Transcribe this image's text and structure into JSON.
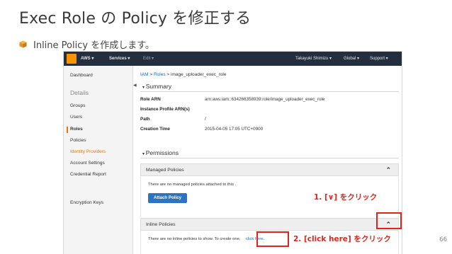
{
  "slide": {
    "title": "Exec Role の Policy を修正する",
    "bullet": "Inline Policy を作成します。",
    "page_number": "66"
  },
  "topbar": {
    "brand": "AWS",
    "services": "Services",
    "edit": "Edit",
    "user": "Takayuki Shimizu",
    "region": "Global",
    "support": "Support"
  },
  "sidebar": {
    "dashboard": "Dashboard",
    "details_heading": "Details",
    "groups": "Groups",
    "users": "Users",
    "roles": "Roles",
    "policies": "Policies",
    "identity_providers": "Identity Providers",
    "account_settings": "Account Settings",
    "credential_report": "Credential Report",
    "encryption_keys": "Encryption Keys"
  },
  "breadcrumb": {
    "iam": "IAM",
    "roles": "Roles",
    "current": "image_uploader_exec_role"
  },
  "summary": {
    "title": "Summary",
    "role_arn_label": "Role ARN",
    "role_arn_value": "arn:aws:iam::634266358939:role/image_uploader_exec_role",
    "profile_arn_label": "Instance Profile ARN(s)",
    "path_label": "Path",
    "path_value": "/",
    "creation_label": "Creation Time",
    "creation_value": "2015-04-05 17:05 UTC+0900"
  },
  "permissions": {
    "title": "Permissions",
    "managed_title": "Managed Policies",
    "managed_empty": "There are no managed policies attached to this .",
    "attach_button": "Attach Policy",
    "inline_title": "Inline Policies",
    "inline_empty": "There are no inline policies to show. To create one,",
    "click_here": "click here."
  },
  "annotations": {
    "step1": "1. [∨] をクリック",
    "step2": "2. [click here] をクリック"
  },
  "colors": {
    "topbar": "#232f3e",
    "accent_orange": "#e77600",
    "button_blue": "#2d73c4",
    "annotation_red": "#e2231a"
  }
}
